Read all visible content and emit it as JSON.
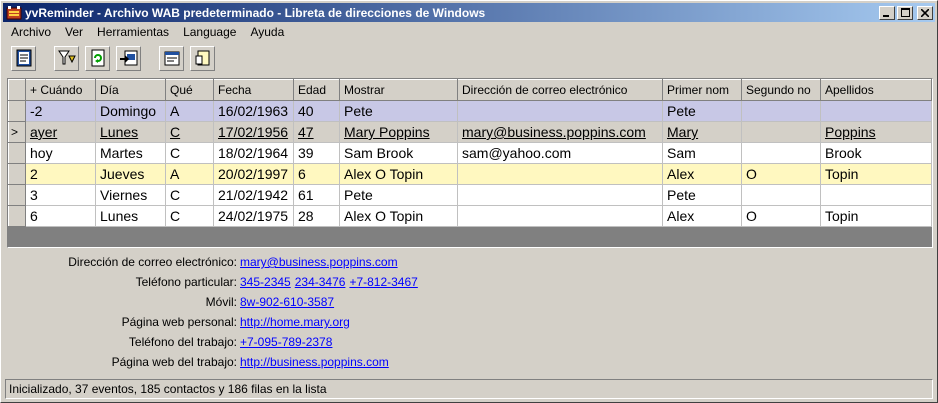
{
  "window": {
    "title": "yvReminder - Archivo WAB predeterminado - Libreta de direcciones de Windows"
  },
  "menu": [
    "Archivo",
    "Ver",
    "Herramientas",
    "Language",
    "Ayuda"
  ],
  "toolbar_icons": [
    "address-book-icon",
    "filter-icon",
    "refresh-icon",
    "export-icon",
    "properties-icon",
    "note-icon"
  ],
  "grid": {
    "columns": [
      "+ Cuándo",
      "Día",
      "Qué",
      "Fecha",
      "Edad",
      "Mostrar",
      "Dirección de correo electrónico",
      "Primer nom",
      "Segundo no",
      "Apellidos"
    ],
    "rows": [
      {
        "indicator": "",
        "cells": [
          "-2",
          "Domingo",
          "A",
          "16/02/1963",
          "40",
          "Pete",
          "",
          "Pete",
          "",
          ""
        ]
      },
      {
        "indicator": ">",
        "cells": [
          "ayer",
          "Lunes",
          "C",
          "17/02/1956",
          "47",
          "Mary Poppins",
          "mary@business.poppins.com",
          "Mary",
          "",
          "Poppins"
        ]
      },
      {
        "indicator": "",
        "cells": [
          "hoy",
          "Martes",
          "C",
          "18/02/1964",
          "39",
          "Sam Brook",
          "sam@yahoo.com",
          "Sam",
          "",
          "Brook"
        ]
      },
      {
        "indicator": "",
        "cells": [
          "2",
          "Jueves",
          "A",
          "20/02/1997",
          "6",
          "Alex O Topin",
          "",
          "Alex",
          "O",
          "Topin"
        ]
      },
      {
        "indicator": "",
        "cells": [
          "3",
          "Viernes",
          "C",
          "21/02/1942",
          "61",
          "Pete",
          "",
          "Pete",
          "",
          ""
        ]
      },
      {
        "indicator": "",
        "cells": [
          "6",
          "Lunes",
          "C",
          "24/02/1975",
          "28",
          "Alex O Topin",
          "",
          "Alex",
          "O",
          "Topin"
        ]
      }
    ]
  },
  "details": {
    "email": {
      "label": "Dirección de correo electrónico:",
      "values": [
        "mary@business.poppins.com"
      ]
    },
    "home_phone": {
      "label": "Teléfono particular:",
      "values": [
        "345-2345",
        "234-3476",
        "+7-812-3467"
      ]
    },
    "mobile": {
      "label": "Móvil:",
      "values": [
        "8w-902-610-3587"
      ]
    },
    "personal_web": {
      "label": "Página web personal:",
      "values": [
        "http://home.mary.org"
      ]
    },
    "work_phone": {
      "label": "Teléfono del trabajo:",
      "values": [
        "+7-095-789-2378"
      ]
    },
    "work_web": {
      "label": "Página web del trabajo:",
      "values": [
        "http://business.poppins.com"
      ]
    }
  },
  "status": "Inicializado, 37 eventos, 185 contactos y 186 filas en la lista"
}
